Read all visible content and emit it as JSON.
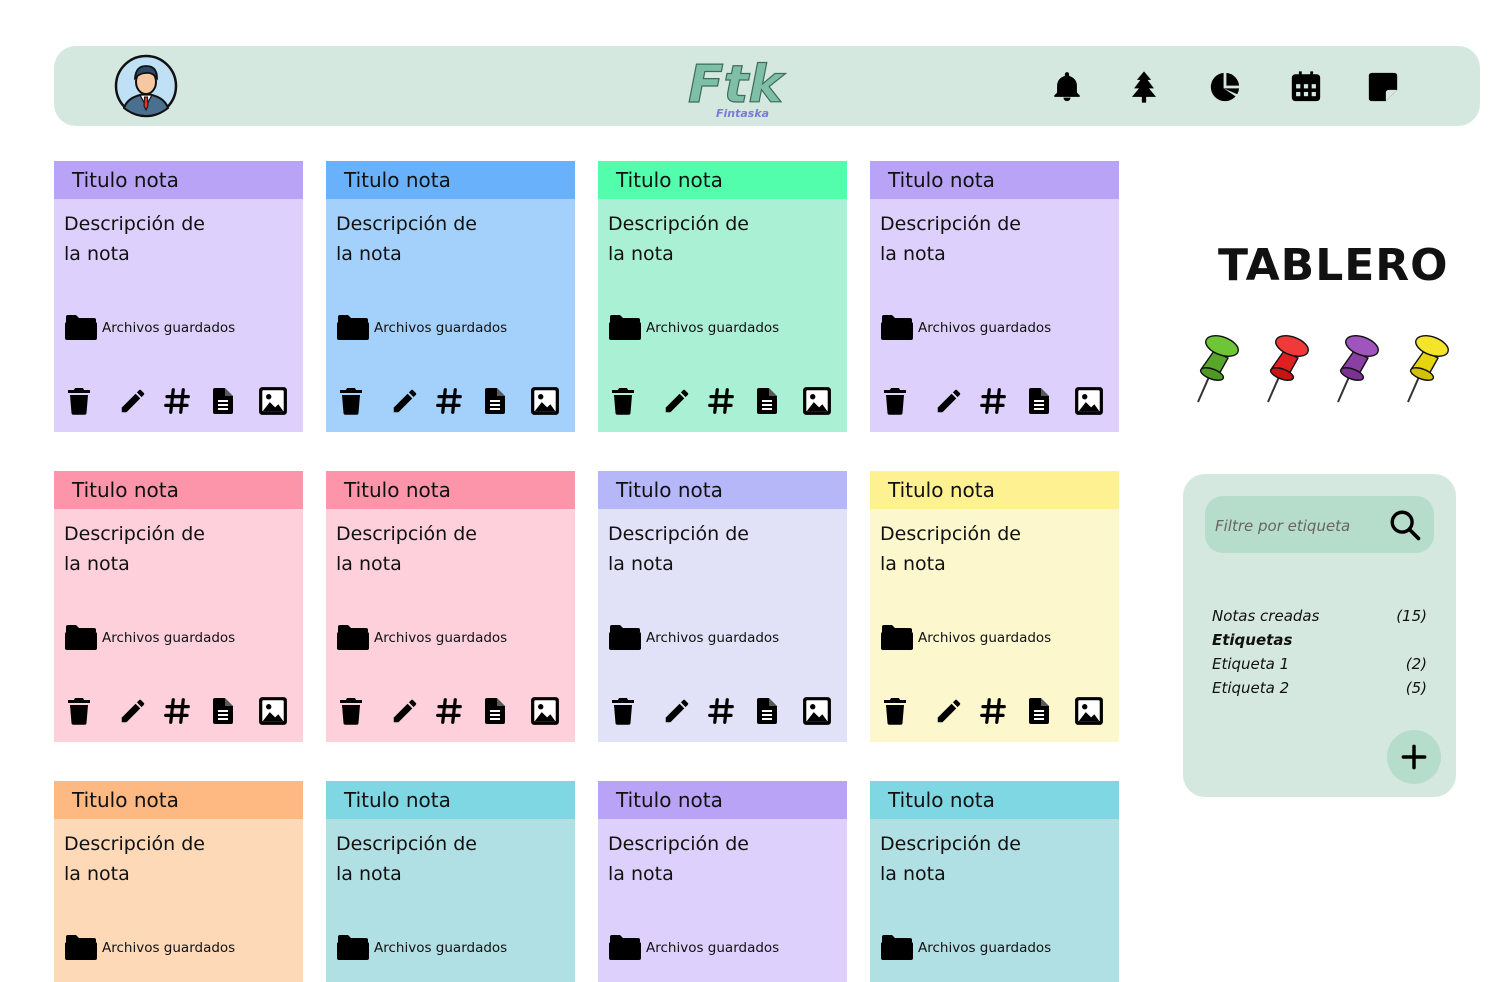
{
  "header": {
    "logo_text": "Ftk",
    "logo_subtext": "Fintaska",
    "icons": [
      "bell-icon",
      "tree-icon",
      "pie-chart-icon",
      "calendar-icon",
      "sticky-note-icon"
    ]
  },
  "board": {
    "title": "TABLERO",
    "pins": [
      "green",
      "red",
      "purple",
      "yellow"
    ]
  },
  "notes": [
    {
      "title": "Titulo nota",
      "description": [
        "Descripción de",
        "la nota"
      ],
      "files_label": "Archivos guardados",
      "head_color": "#b8a3f7",
      "body_color": "#ddd0fc",
      "has_tools": true
    },
    {
      "title": "Titulo nota",
      "description": [
        "Descripción de",
        "la nota"
      ],
      "files_label": "Archivos guardados",
      "head_color": "#69b2fb",
      "body_color": "#a4d0fc",
      "has_tools": true
    },
    {
      "title": "Titulo nota",
      "description": [
        "Descripción de",
        "la nota"
      ],
      "files_label": "Archivos guardados",
      "head_color": "#52feac",
      "body_color": "#aaf0d4",
      "has_tools": true
    },
    {
      "title": "Titulo nota",
      "description": [
        "Descripción de",
        "la nota"
      ],
      "files_label": "Archivos guardados",
      "head_color": "#b8a3f7",
      "body_color": "#ddd0fc",
      "has_tools": true
    },
    {
      "title": "Titulo nota",
      "description": [
        "Descripción de",
        "la nota"
      ],
      "files_label": "Archivos guardados",
      "head_color": "#fc95aa",
      "body_color": "#fdd0db",
      "has_tools": true
    },
    {
      "title": "Titulo nota",
      "description": [
        "Descripción de",
        "la nota"
      ],
      "files_label": "Archivos guardados",
      "head_color": "#fc95aa",
      "body_color": "#fdd0db",
      "has_tools": true
    },
    {
      "title": "Titulo nota",
      "description": [
        "Descripción de",
        "la nota"
      ],
      "files_label": "Archivos guardados",
      "head_color": "#b5b7f8",
      "body_color": "#e1e2f8",
      "has_tools": true
    },
    {
      "title": "Titulo nota",
      "description": [
        "Descripción de",
        "la nota"
      ],
      "files_label": "Archivos guardados",
      "head_color": "#fdf192",
      "body_color": "#fcf7cc",
      "has_tools": true
    },
    {
      "title": "Titulo nota",
      "description": [
        "Descripción de",
        "la nota"
      ],
      "files_label": "Archivos guardados",
      "head_color": "#feb882",
      "body_color": "#fdd9b8",
      "has_tools": false
    },
    {
      "title": "Titulo nota",
      "description": [
        "Descripción de",
        "la nota"
      ],
      "files_label": "Archivos guardados",
      "head_color": "#7fd7e3",
      "body_color": "#b0e0e4",
      "has_tools": false
    },
    {
      "title": "Titulo nota",
      "description": [
        "Descripción de",
        "la nota"
      ],
      "files_label": "Archivos guardados",
      "head_color": "#b8a3f7",
      "body_color": "#ddd0fc",
      "has_tools": false
    },
    {
      "title": "Titulo nota",
      "description": [
        "Descripción de",
        "la nota"
      ],
      "files_label": "Archivos guardados",
      "head_color": "#7fd7e3",
      "body_color": "#b0e0e4",
      "has_tools": false
    }
  ],
  "note_tools": [
    "trash-icon",
    "pencil-icon",
    "hashtag-icon",
    "document-icon",
    "image-icon"
  ],
  "panel": {
    "search_placeholder": "Filtre por etiqueta",
    "stats": [
      {
        "label": "Notas creadas",
        "value": "(15)",
        "bold": false
      },
      {
        "label": "Etiquetas",
        "value": "",
        "bold": true
      },
      {
        "label": "Etiqueta 1",
        "value": "(2)",
        "bold": false
      },
      {
        "label": "Etiqueta 2",
        "value": "(5)",
        "bold": false
      }
    ],
    "add_icon": "plus-icon"
  },
  "colors": {
    "header_bg": "#d5e8df",
    "panel_bg": "#d5e8df",
    "search_bg": "#b6dccb"
  }
}
